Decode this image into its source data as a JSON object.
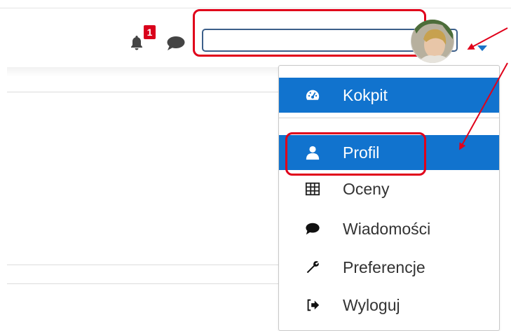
{
  "header": {
    "notification_icon": "bell-icon",
    "notification_count": "1",
    "messages_icon": "chat-bubble-icon",
    "user_menu_toggle_icon": "caret-down-icon"
  },
  "user_menu": {
    "items": [
      {
        "label": "Kokpit",
        "icon": "dashboard-icon",
        "active": true
      },
      {
        "label": "Profil",
        "icon": "user-icon",
        "active": true
      },
      {
        "label": "Oceny",
        "icon": "table-icon",
        "active": false
      },
      {
        "label": "Wiadomości",
        "icon": "chat-bubble-icon",
        "active": false
      },
      {
        "label": "Preferencje",
        "icon": "wrench-icon",
        "active": false
      },
      {
        "label": "Wyloguj",
        "icon": "sign-out-icon",
        "active": false
      }
    ]
  },
  "colors": {
    "accent": "#1173ce",
    "highlight_annotation": "#e0001a",
    "badge": "#d9001b"
  }
}
